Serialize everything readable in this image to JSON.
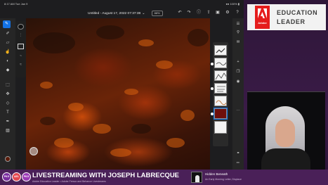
{
  "status_bar": {
    "time": "8:17 AM",
    "date": "Tue Jan 9",
    "right": "●● 100% ▮"
  },
  "app": {
    "doc_title": "Untitled - August 17, 2022 07:37:38",
    "title_chevron": "⌄",
    "zoom_label": "88%",
    "top_icons": [
      "undo-icon",
      "redo-icon",
      "info-icon",
      "share-icon",
      "export-icon",
      "settings-icon",
      "help-icon"
    ],
    "left_tools": [
      "brush-icon",
      "pencil-icon",
      "eraser-icon",
      "smudge-icon",
      "blend-icon",
      "fill-icon",
      "selection-icon",
      "transform-icon",
      "shape-icon",
      "text-icon",
      "eyedropper-icon",
      "image-icon"
    ],
    "right_tools": [
      "layers-icon",
      "properties-icon",
      "comment-icon",
      "add-layer-icon",
      "group-icon",
      "visibility-icon",
      "more-icon"
    ],
    "current_color": "#5a1a08"
  },
  "badge": {
    "logo_text": "Adobe",
    "line1": "EDUCATION",
    "line2": "LEADER",
    "logo_color": "#e51c1c"
  },
  "bottom_bar": {
    "badges": [
      "PKG",
      "AEL",
      "PKG"
    ],
    "title": "LIVESTREAMING WITH JOSEPH LABRECQUE",
    "subtitle": "Adobe Education Leader • Adobe Fresco and Behance Livestreams",
    "song": "Hidden Beneath",
    "artist": "An Early Morning Letter, Displace"
  }
}
